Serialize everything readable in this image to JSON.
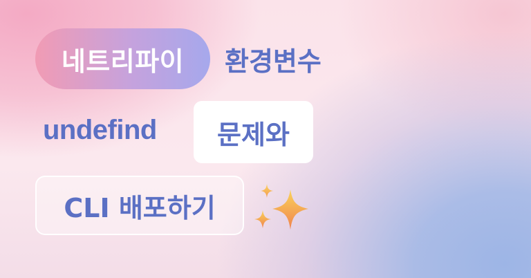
{
  "badges": {
    "netlify": "네트리파이",
    "env": "환경변수",
    "undefined_text": "undefind",
    "problem": "문제와",
    "deploy": "CLI 배포하기"
  },
  "icons": {
    "sparkles": "sparkles-icon"
  },
  "colors": {
    "text_blue": "#5b70c4",
    "gradient_start": "#f19bb4",
    "gradient_end": "#a6a8ec",
    "sparkle_top": "#f9c955",
    "sparkle_bottom": "#f28a4e"
  }
}
